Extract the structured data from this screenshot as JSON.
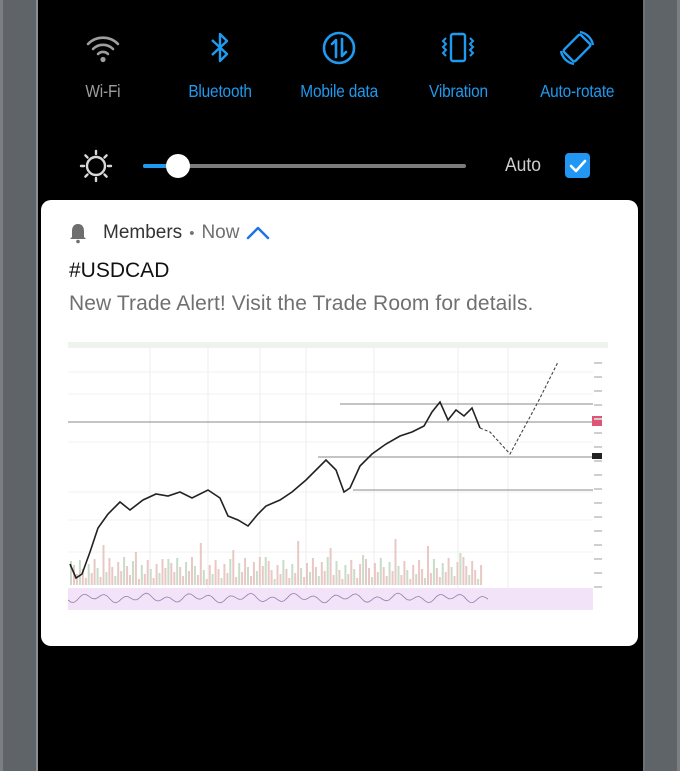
{
  "quick_settings": {
    "tiles": [
      {
        "label": "Wi-Fi",
        "icon": "wifi-icon",
        "state": "off"
      },
      {
        "label": "Bluetooth",
        "icon": "bluetooth-icon",
        "state": "on"
      },
      {
        "label": "Mobile data",
        "icon": "mobile-data-icon",
        "state": "on"
      },
      {
        "label": "Vibration",
        "icon": "vibration-icon",
        "state": "on"
      },
      {
        "label": "Auto-rotate",
        "icon": "auto-rotate-icon",
        "state": "on"
      }
    ],
    "brightness": {
      "icon": "brightness-icon",
      "level_percent": 7,
      "auto_label": "Auto",
      "auto_checked": true
    },
    "colors": {
      "active": "#1e9af0",
      "inactive": "#9e9e9e",
      "checkbox": "#2196f3"
    }
  },
  "notification": {
    "app_icon": "bell-icon",
    "app_name": "Members",
    "separator": "•",
    "time": "Now",
    "expand_icon": "chevron-up-icon",
    "title": "#USDCAD",
    "body": "New Trade Alert! Visit the Trade Room for details.",
    "attachment": {
      "kind": "chart-screenshot",
      "description": "USDCAD candlestick price chart with horizontal levels, volume bars, oscillator panel and projected dashed path"
    }
  }
}
